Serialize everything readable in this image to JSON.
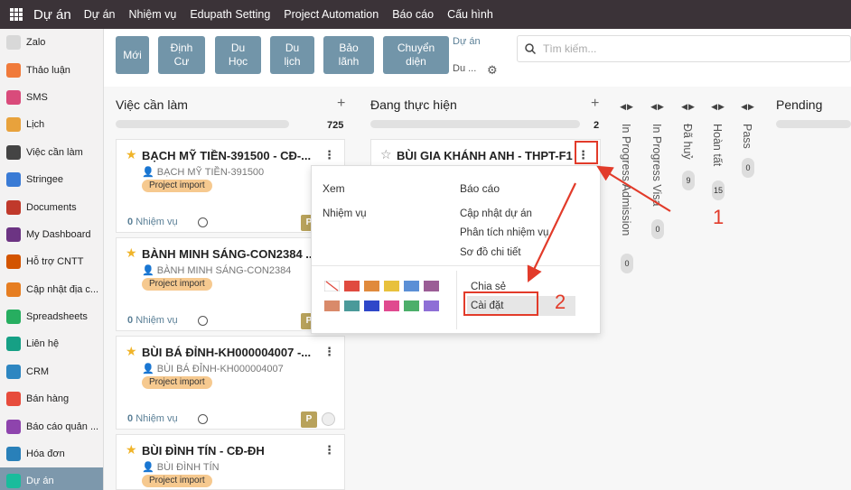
{
  "topbar": {
    "brand": "Dự án",
    "menu": [
      "Dự án",
      "Nhiệm vụ",
      "Edupath Setting",
      "Project Automation",
      "Báo cáo",
      "Cấu hình"
    ]
  },
  "sidebar": {
    "items": [
      {
        "label": "Zalo",
        "color": "#d8d8d8"
      },
      {
        "label": "Thảo luận",
        "color": "#f07a3a"
      },
      {
        "label": "SMS",
        "color": "#d94b7b"
      },
      {
        "label": "Lịch",
        "color": "#e8a23c"
      },
      {
        "label": "Việc cần làm",
        "color": "#444444"
      },
      {
        "label": "Stringee",
        "color": "#3a7bd5"
      },
      {
        "label": "Documents",
        "color": "#c0392b"
      },
      {
        "label": "My Dashboard",
        "color": "#6c3483"
      },
      {
        "label": "Hỗ trợ CNTT",
        "color": "#d35400"
      },
      {
        "label": "Cập nhật địa c...",
        "color": "#e67e22"
      },
      {
        "label": "Spreadsheets",
        "color": "#27ae60"
      },
      {
        "label": "Liên hệ",
        "color": "#16a085"
      },
      {
        "label": "CRM",
        "color": "#2e86c1"
      },
      {
        "label": "Bán hàng",
        "color": "#e74c3c"
      },
      {
        "label": "Báo cáo quản ...",
        "color": "#8e44ad"
      },
      {
        "label": "Hóa đơn",
        "color": "#2980b9"
      },
      {
        "label": "Dự án",
        "color": "#1abc9c"
      }
    ]
  },
  "toolbar": {
    "buttons": [
      "Mới",
      "Định Cư",
      "Du Học",
      "Du lịch",
      "Bảo lãnh",
      "Chuyển diện"
    ],
    "breadcrumb_top": "Dự án",
    "breadcrumb_bottom": "Du ...",
    "search_placeholder": "Tìm kiếm..."
  },
  "columns": {
    "todo": {
      "title": "Việc cần làm",
      "count": "725",
      "cards": [
        {
          "title": "BẠCH MỸ TIỀN-391500 - CĐ-...",
          "sub": "BẠCH MỸ TIỀN-391500",
          "tag": "Project import",
          "tasks_count": "0",
          "tasks_label": "Nhiệm vụ",
          "avatar": "P"
        },
        {
          "title": "BÀNH MINH SÁNG-CON2384 ...",
          "sub": "BÀNH MINH SÁNG-CON2384",
          "tag": "Project import",
          "tasks_count": "0",
          "tasks_label": "Nhiệm vụ",
          "avatar": "P"
        },
        {
          "title": "BÙI BÁ ĐỈNH-KH000004007 -...",
          "sub": "BÙI BÁ ĐỈNH-KH000004007",
          "tag": "Project import",
          "tasks_count": "0",
          "tasks_label": "Nhiệm vụ",
          "avatar": "P"
        },
        {
          "title": "BÙI ĐÌNH TÍN - CĐ-ĐH",
          "sub": "BÙI ĐÌNH TÍN",
          "tag": "Project import"
        }
      ]
    },
    "doing": {
      "title": "Đang thực hiện",
      "count": "2",
      "card": {
        "title": "BÙI GIA KHÁNH ANH - THPT-F1"
      }
    },
    "folded": [
      {
        "label": "In Progress Admission",
        "count": "0"
      },
      {
        "label": "In Progress Visa",
        "count": "0"
      },
      {
        "label": "Đã huỷ",
        "count": "9"
      },
      {
        "label": "Hoàn tất",
        "count": "15"
      },
      {
        "label": "Pass",
        "count": "0"
      }
    ],
    "pending": {
      "title": "Pending"
    }
  },
  "dropdown": {
    "view_header": "Xem",
    "view_items": [
      "Nhiệm vụ"
    ],
    "report_header": "Báo cáo",
    "report_items": [
      "Cập nhật dự án",
      "Phân tích nhiệm vụ",
      "Sơ đồ chi tiết"
    ],
    "share": "Chia sẻ",
    "settings": "Cài đặt",
    "colors": [
      "#ffffff",
      "#e04a3f",
      "#e08a3c",
      "#e8c13c",
      "#5b8fd6",
      "#9b5d96",
      "#d98a6a",
      "#4b9a9a",
      "#2f47c9",
      "#e04a8f",
      "#4caf6a",
      "#8e6fd6"
    ]
  },
  "annotations": {
    "first": "1",
    "second": "2",
    "color": "#e23b2a"
  }
}
